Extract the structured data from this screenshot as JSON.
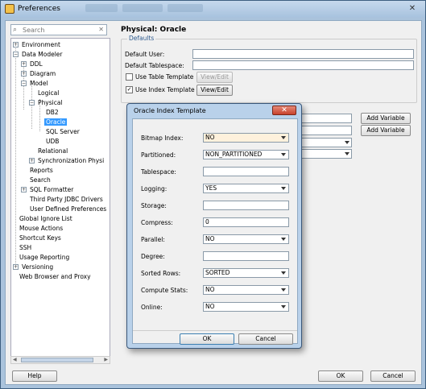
{
  "window": {
    "title": "Preferences",
    "close_icon": "close-icon"
  },
  "search": {
    "placeholder": "Search"
  },
  "tree": {
    "environment": "Environment",
    "data_modeler": "Data Modeler",
    "ddl": "DDL",
    "diagram": "Diagram",
    "model": "Model",
    "logical": "Logical",
    "physical": "Physical",
    "db2": "DB2",
    "oracle": "Oracle",
    "sql_server": "SQL Server",
    "udb": "UDB",
    "relational": "Relational",
    "sync": "Synchronization Physi",
    "reports": "Reports",
    "search": "Search",
    "sql_formatter": "SQL Formatter",
    "third_party": "Third Party JDBC Drivers",
    "user_defined": "User Defined Preferences",
    "global_ignore": "Global Ignore List",
    "mouse": "Mouse Actions",
    "shortcut": "Shortcut Keys",
    "ssh": "SSH",
    "usage": "Usage Reporting",
    "versioning": "Versioning",
    "web": "Web Browser and Proxy"
  },
  "panel": {
    "title": "Physical: Oracle"
  },
  "defaults": {
    "legend": "Defaults",
    "default_user": "Default User:",
    "default_tablespace": "Default Tablespace:",
    "use_table_template": "Use Table Template",
    "use_index_template": "Use Index Template",
    "view_edit": "View/Edit",
    "table_checked": false,
    "index_checked": true
  },
  "vars": {
    "add_variable": "Add Variable"
  },
  "footer": {
    "help": "Help",
    "ok": "OK",
    "cancel": "Cancel"
  },
  "dialog": {
    "title": "Oracle Index Template",
    "rows": [
      {
        "label": "Bitmap Index:",
        "value": "NO"
      },
      {
        "label": "Partitioned:",
        "value": "NON_PARTITIONED"
      },
      {
        "label": "Tablespace:",
        "value": ""
      },
      {
        "label": "Logging:",
        "value": "YES"
      },
      {
        "label": "Storage:",
        "value": ""
      },
      {
        "label": "Compress:",
        "value": "0"
      },
      {
        "label": "Parallel:",
        "value": "NO"
      },
      {
        "label": "Degree:",
        "value": ""
      },
      {
        "label": "Sorted Rows:",
        "value": "SORTED"
      },
      {
        "label": "Compute Stats:",
        "value": "NO"
      },
      {
        "label": "Online:",
        "value": "NO"
      }
    ],
    "ok": "OK",
    "cancel": "Cancel"
  }
}
